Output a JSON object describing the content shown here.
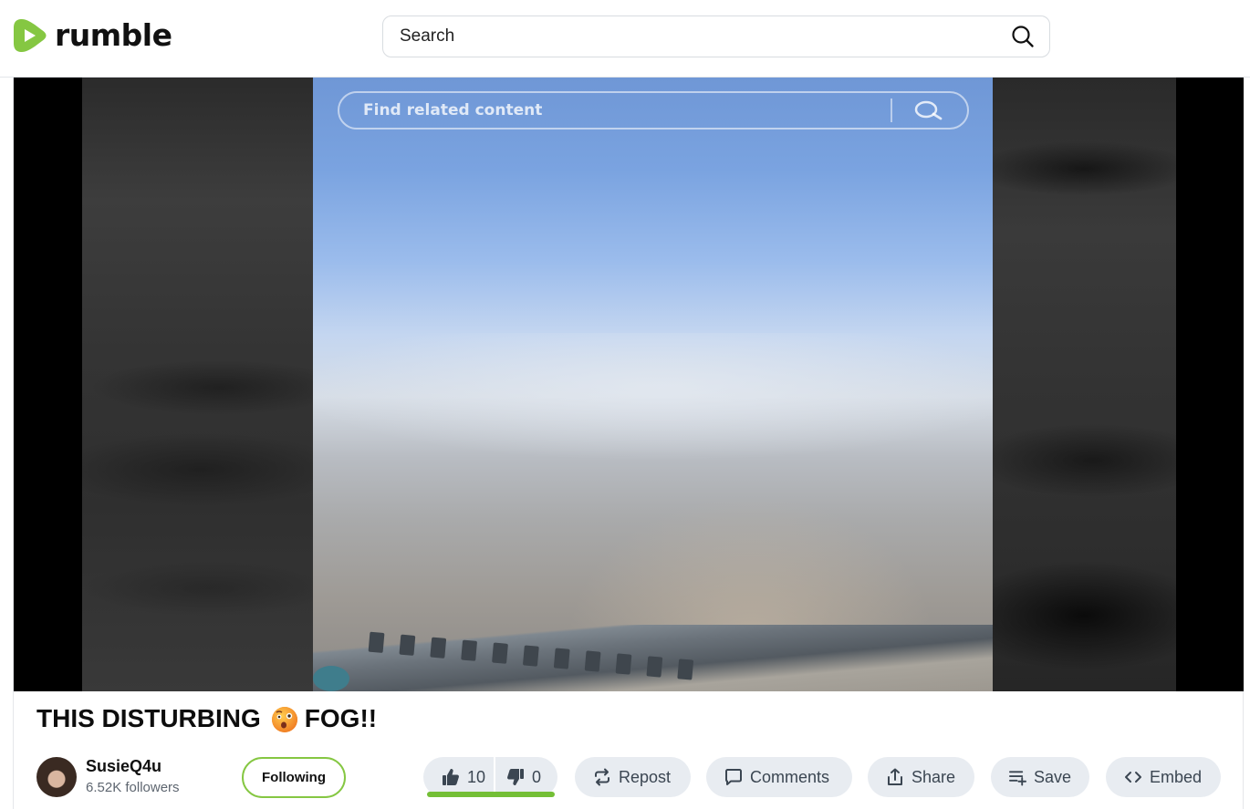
{
  "header": {
    "logo_text": "rumble",
    "search_placeholder": "Search"
  },
  "video": {
    "overlay_search_text": "Find related content"
  },
  "title": {
    "text_before": "THIS DISTURBING",
    "emoji_icon": "face-with-open-mouth-emoji",
    "text_after": "FOG!!"
  },
  "channel": {
    "name": "SusieQ4u",
    "followers": "6.52K followers",
    "follow_label": "Following"
  },
  "actions": {
    "likes": "10",
    "dislikes": "0",
    "like_ratio": 1.0,
    "repost": "Repost",
    "comments": "Comments",
    "share": "Share",
    "save": "Save",
    "embed": "Embed"
  },
  "colors": {
    "brand_green": "#85c742",
    "button_bg": "#e8ecf1",
    "text_dark": "#0d0d0d"
  }
}
